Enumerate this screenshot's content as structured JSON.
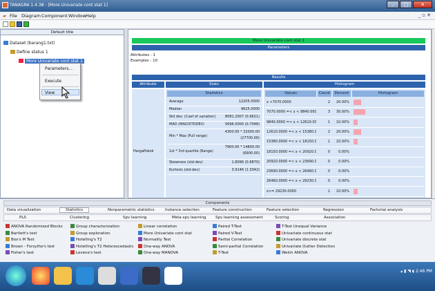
{
  "window": {
    "title": "TANAGRA 1.4.38 - [More Univariate cont stat 1]"
  },
  "menu": [
    "File",
    "Diagram",
    "Component",
    "Window",
    "Help"
  ],
  "left": {
    "header": "Default title",
    "dataset": "Dataset (barang1.txt)",
    "define": "Define status 1",
    "selected": "More Univariate cont stat 1"
  },
  "context_menu": [
    "Parameters...",
    "Execute",
    "View"
  ],
  "right": {
    "banner": "More Univariate cont stat 1",
    "params": "Parameters",
    "attributes": "Attributes : 1",
    "examples": "Examples : 10",
    "results": "Results",
    "col_attribute": "Attribute",
    "col_stats": "Stats",
    "col_hist": "Histogram",
    "sub_stats": "Statistics",
    "sub_values": "Values",
    "sub_count": "Count",
    "sub_percent": "Percent",
    "sub_hist": "Histogram",
    "attr_name": "HargaPokok",
    "stats": [
      {
        "label": "Average",
        "value": "12205.0000"
      },
      {
        "label": "Median",
        "value": "9625.0000"
      },
      {
        "label": "Std dev. (Coef of variation)",
        "value": "8081.2007 (0.6621)"
      },
      {
        "label": "MAD (MAD/STDDEV)",
        "value": "5696.0000 (0.7048)"
      },
      {
        "label": "Min * Max (Full range)",
        "value": "4300.00 * 32000.00",
        "value2": "(27700.00)"
      },
      {
        "label": "1st * 3rd quartile (Range)",
        "value": "7900.00 * 14800.00",
        "value2": "(6900.00)"
      },
      {
        "label": "Skewness (std-dev)",
        "value": "1.8096 (0.6870)"
      },
      {
        "label": "Kurtosis (std-dev)",
        "value": "3.9146 (1.3342)"
      }
    ],
    "hist": [
      {
        "range": "x <7070.0000",
        "count": "2",
        "percent": "20.00%",
        "frac": 0.2
      },
      {
        "range": "7070.0000 =< x < 9840.0000",
        "count": "3",
        "percent": "30.00%",
        "frac": 0.3
      },
      {
        "range": "9840.0000 =< x < 12610.0000",
        "count": "1",
        "percent": "10.00%",
        "frac": 0.1
      },
      {
        "range": "12610.0000 =< x < 15380.0000",
        "count": "2",
        "percent": "20.00%",
        "frac": 0.2
      },
      {
        "range": "15380.0000 =< x < 18150.0000",
        "count": "1",
        "percent": "10.00%",
        "frac": 0.1
      },
      {
        "range": "18150.0000 =< x < 20920.0000",
        "count": "0",
        "percent": "0.00%",
        "frac": 0
      },
      {
        "range": "20920.0000 =< x < 23690.0000",
        "count": "0",
        "percent": "0.00%",
        "frac": 0
      },
      {
        "range": "23690.0000 =< x < 26460.0000",
        "count": "0",
        "percent": "0.00%",
        "frac": 0
      },
      {
        "range": "26460.0000 =< x < 29230.0000",
        "count": "0",
        "percent": "0.00%",
        "frac": 0
      },
      {
        "range": "x>= 29230.0000",
        "count": "1",
        "percent": "10.00%",
        "frac": 0.1
      }
    ]
  },
  "palette": {
    "header": "Components",
    "tabs1": [
      "Data visualization",
      "Statistics",
      "Nonparametric statistics",
      "Instance selection",
      "Feature construction",
      "Feature selection",
      "Regression",
      "Factorial analysis"
    ],
    "tabs2": [
      "PLS",
      "Clustering",
      "Spv learning",
      "Meta-spv learning",
      "Spv learning assessment",
      "Scoring",
      "Association"
    ],
    "col1": [
      "ANOVA Randomized Blocks",
      "Bartlett's test",
      "Box's M Test",
      "Brown - Forsythe's test",
      "Fisher's test"
    ],
    "col2": [
      "Group characterization",
      "Group exploration",
      "Hotelling's T2",
      "Hotelling's T2 Heteroscedastic",
      "Levene's test"
    ],
    "col3": [
      "Linear correlation",
      "More Univariate cont stat",
      "Normality Test",
      "One-way ANOVA",
      "One-way MANOVA"
    ],
    "col4": [
      "Paired T-Test",
      "Paired V-Test",
      "Partial Correlation",
      "Semi-partial Correlation",
      "T-Test"
    ],
    "col5": [
      "T-Test Unequal Variance",
      "Univariate continuous stat",
      "Univariate discrete stat",
      "Univariate Outlier Detection",
      "Welch ANOVA"
    ]
  },
  "tray": {
    "time": "2:46 PM"
  }
}
